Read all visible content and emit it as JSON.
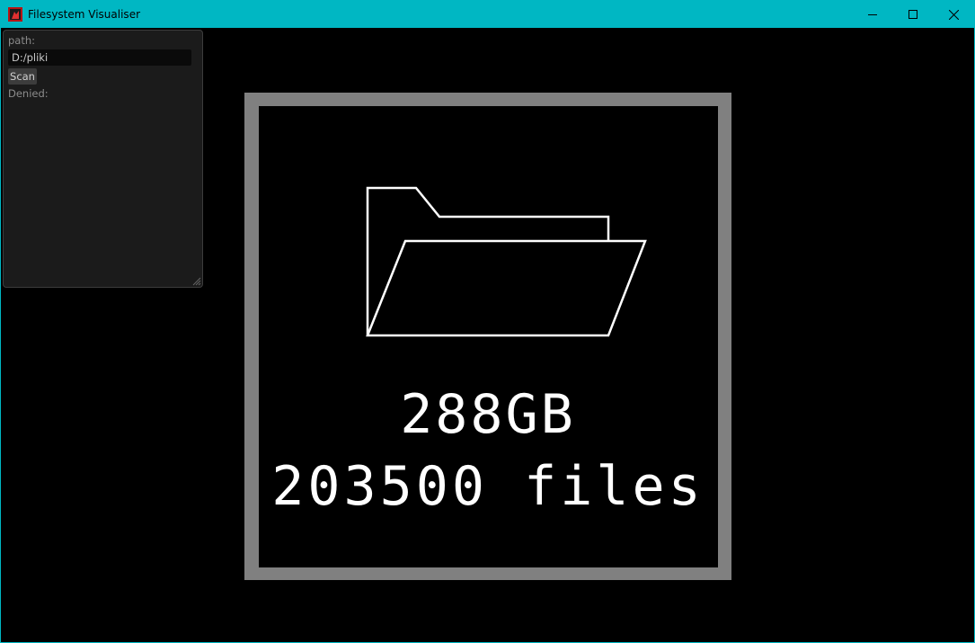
{
  "window": {
    "title": "Filesystem Visualiser",
    "icon": "app-icon",
    "accent_color": "#00b7c3",
    "controls": [
      "minimize-icon",
      "maximize-icon",
      "close-icon"
    ]
  },
  "panel": {
    "path_label": "path:",
    "path_value": "D:/pliki",
    "scan_label": "Scan",
    "denied_label": "Denied:"
  },
  "visual": {
    "icon": "folder-icon",
    "size": "288GB",
    "files": "203500 files"
  }
}
